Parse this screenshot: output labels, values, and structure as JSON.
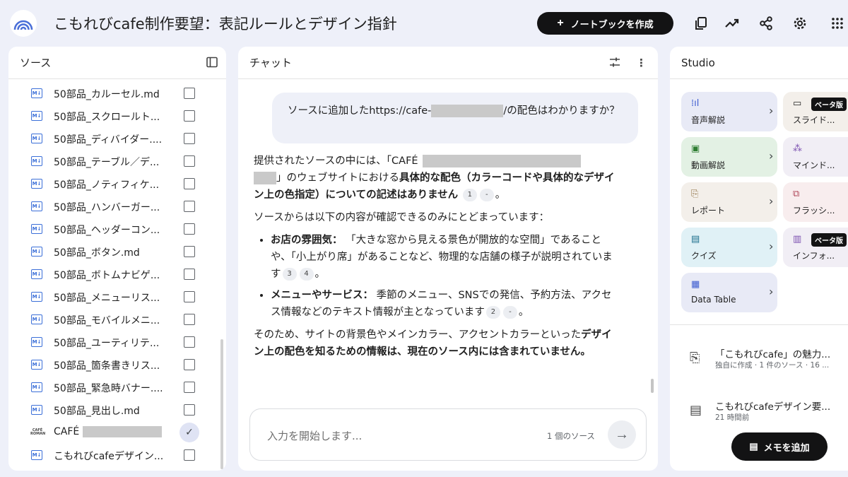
{
  "header": {
    "title": "こもれびcafe制作要望：表記ルールとデザイン指針",
    "create_label": "ノートブックを作成"
  },
  "sources": {
    "title": "ソース",
    "items": [
      {
        "name": "50部品_カルーセル.md",
        "checked": false
      },
      {
        "name": "50部品_スクロールト...",
        "checked": false
      },
      {
        "name": "50部品_ディバイダー....",
        "checked": false
      },
      {
        "name": "50部品_テーブル／デ...",
        "checked": false
      },
      {
        "name": "50部品_ノティフィケ...",
        "checked": false
      },
      {
        "name": "50部品_ハンバーガー...",
        "checked": false
      },
      {
        "name": "50部品_ヘッダーコン...",
        "checked": false
      },
      {
        "name": "50部品_ボタン.md",
        "checked": false
      },
      {
        "name": "50部品_ボトムナビゲ...",
        "checked": false
      },
      {
        "name": "50部品_メニューリス...",
        "checked": false
      },
      {
        "name": "50部品_モバイルメニ...",
        "checked": false
      },
      {
        "name": "50部品_ユーティリテ...",
        "checked": false
      },
      {
        "name": "50部品_箇条書きリス...",
        "checked": false
      },
      {
        "name": "50部品_緊急時バナー....",
        "checked": false
      },
      {
        "name": "50部品_見出し.md",
        "checked": false
      },
      {
        "name": "CAFÉ",
        "checked": true,
        "logo_text": "CAFÉ ROMAN"
      },
      {
        "name": "こもれびcafeデザイン...",
        "checked": false
      }
    ]
  },
  "chat": {
    "title": "チャット",
    "user_message_a": "ソースに追加したhttps://cafe-",
    "user_message_b": "/の配色はわかりますか？",
    "p1_a": "提供されたソースの中には、「CAFÉ",
    "p1_b": "」のウェブサイトにおける",
    "p1_bold": "具体的な配色（カラーコードや具体的なデザイン上の色指定）についての記述はありません",
    "p1_cites": [
      "1",
      "-"
    ],
    "p2": "ソースからは以下の内容が確認できるのみにとどまっています：",
    "b1_label": "お店の雰囲気：",
    "b1_text": "「大きな窓から見える景色が開放的な空間」であることや、「小上がり席」があることなど、物理的な店舗の様子が説明されています",
    "b1_cites": [
      "3",
      "4"
    ],
    "b2_label": "メニューやサービス：",
    "b2_text": "季節のメニュー、SNSでの発信、予約方法、アクセス情報などのテキスト情報が主となっています",
    "b2_cites": [
      "2",
      "-"
    ],
    "p3_a": "そのため、サイトの背景色やメインカラー、アクセントカラーといった",
    "p3_bold": "デザイン上の配色を知るための情報は、現在のソース内には含まれていません。",
    "input_placeholder": "入力を開始します...",
    "source_count": "1 個のソース"
  },
  "studio": {
    "title": "Studio",
    "cards": [
      {
        "label": "音声解説",
        "bg": "#e8eaf6"
      },
      {
        "label": "スライド...",
        "bg": "#f3efea",
        "beta": "ベータ版"
      },
      {
        "label": "動画解説",
        "bg": "#e3f1e4"
      },
      {
        "label": "マインド...",
        "bg": "#f1eef5"
      },
      {
        "label": "レポート",
        "bg": "#f3efea"
      },
      {
        "label": "フラッシ...",
        "bg": "#f8edee"
      },
      {
        "label": "クイズ",
        "bg": "#e0f1f6"
      },
      {
        "label": "インフォ...",
        "bg": "#f1eef5",
        "beta": "ベータ版"
      },
      {
        "label": "Data Table",
        "bg": "#e8eaf6"
      }
    ],
    "notes": [
      {
        "title": "「こもれびcafe」の魅力...",
        "sub": "独自に作成 · 1 件のソース · 16 ..."
      },
      {
        "title": "こもれびcafeデザイン要...",
        "sub": "21 時間前"
      }
    ],
    "add_note_label": "メモを追加"
  }
}
